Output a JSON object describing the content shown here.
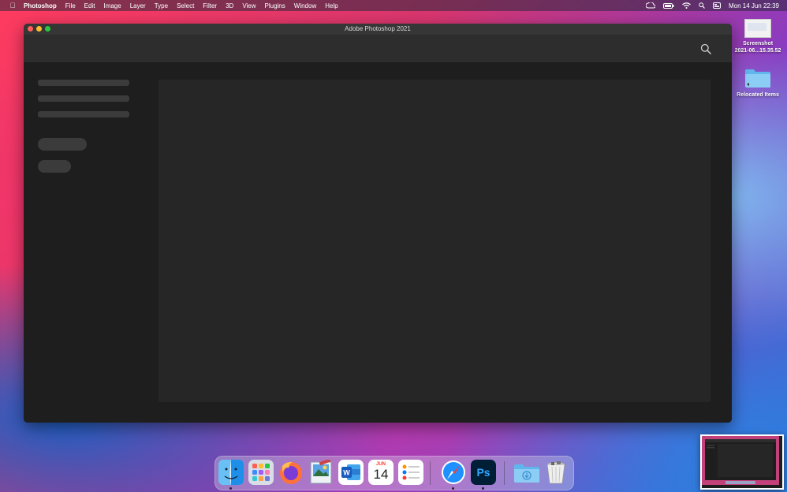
{
  "menubar": {
    "app_name": "Photoshop",
    "items": [
      "File",
      "Edit",
      "Image",
      "Layer",
      "Type",
      "Select",
      "Filter",
      "3D",
      "View",
      "Plugins",
      "Window",
      "Help"
    ],
    "clock": "Mon 14 Jun  22:39",
    "status_icons": [
      "creative-cloud-icon",
      "battery-icon",
      "wifi-icon",
      "search-icon",
      "control-center-icon"
    ]
  },
  "window": {
    "title": "Adobe Photoshop 2021"
  },
  "desktop": {
    "icons": [
      {
        "name": "Screenshot",
        "subtitle": "2021-06...15.35.52"
      },
      {
        "name": "Relocated Items"
      }
    ]
  },
  "dock": {
    "items": [
      {
        "name": "Finder",
        "icon": "finder-icon",
        "running": true
      },
      {
        "name": "Launchpad",
        "icon": "launchpad-icon",
        "running": false
      },
      {
        "name": "Firefox",
        "icon": "firefox-icon",
        "running": false
      },
      {
        "name": "Preview",
        "icon": "preview-icon",
        "running": false
      },
      {
        "name": "Microsoft Word",
        "icon": "word-icon",
        "running": false
      },
      {
        "name": "Calendar",
        "icon": "calendar-icon",
        "running": false,
        "month": "JUN",
        "day": "14"
      },
      {
        "name": "Reminders",
        "icon": "reminders-icon",
        "running": false
      },
      {
        "name": "Safari",
        "icon": "safari-icon",
        "running": true
      },
      {
        "name": "Photoshop",
        "icon": "photoshop-icon",
        "running": true,
        "label": "Ps"
      },
      {
        "name": "Downloads",
        "icon": "downloads-folder-icon",
        "running": false
      },
      {
        "name": "Trash",
        "icon": "trash-icon",
        "running": false
      }
    ]
  },
  "colors": {
    "window_bg": "#1e1e1e",
    "topbar_bg": "#2d2d2d",
    "panel_bg": "#262626",
    "skeleton": "#3b3b3b",
    "photoshop_blue": "#31a8ff",
    "photoshop_bg": "#001e36"
  }
}
